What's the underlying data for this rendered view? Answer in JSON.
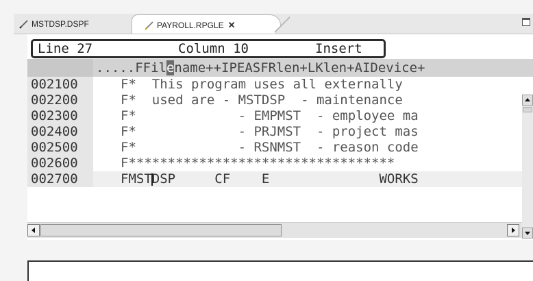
{
  "tabs": [
    {
      "label": "MSTDSP.DSPF",
      "active": false
    },
    {
      "label": "PAYROLL.RPGLE",
      "active": true
    }
  ],
  "status": {
    "line": "Line 27",
    "column": "Column 10",
    "mode": "Insert"
  },
  "ruler": {
    "prefix": ".....FFil",
    "cursor_char": "e",
    "suffix": "name++IPEASFRlen+LKlen+AIDevice+"
  },
  "rows": [
    {
      "num": "002100",
      "code": "F*  This program uses all externally"
    },
    {
      "num": "002200",
      "code": "F*  used are - MSTDSP  - maintenance"
    },
    {
      "num": "002300",
      "code": "F*             - EMPMST  - employee ma"
    },
    {
      "num": "002400",
      "code": "F*             - PRJMST  - project mas"
    },
    {
      "num": "002500",
      "code": "F*             - RSNMST  - reason code"
    },
    {
      "num": "002600",
      "code": "F**********************************"
    },
    {
      "num": "002700",
      "code_before": "FMST",
      "code_after": "DSP     CF    E              WORKS"
    }
  ],
  "icons": {
    "tab_edit": "pencil-icon",
    "close": "close-icon",
    "maximize": "maximize-icon",
    "scroll_up": "arrow-up-icon",
    "scroll_down": "arrow-down-icon",
    "scroll_left": "arrow-left-icon",
    "scroll_right": "arrow-right-icon"
  }
}
